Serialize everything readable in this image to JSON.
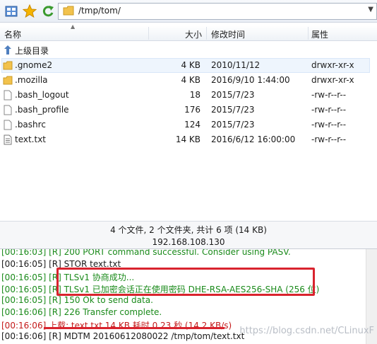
{
  "toolbar": {
    "path": "/tmp/tom/"
  },
  "header": {
    "name": "名称",
    "size": "大小",
    "modified": "修改时间",
    "attrs": "属性"
  },
  "files": [
    {
      "name": "上级目录",
      "size": "",
      "date": "",
      "perm": "",
      "icon": "up-folder-icon"
    },
    {
      "name": ".gnome2",
      "size": "4 KB",
      "date": "2010/11/12",
      "perm": "drwxr-xr-x",
      "icon": "folder-icon"
    },
    {
      "name": ".mozilla",
      "size": "4 KB",
      "date": "2016/9/10 1:44:00",
      "perm": "drwxr-xr-x",
      "icon": "folder-icon"
    },
    {
      "name": ".bash_logout",
      "size": "18",
      "date": "2015/7/23",
      "perm": "-rw-r--r--",
      "icon": "file-icon"
    },
    {
      "name": ".bash_profile",
      "size": "176",
      "date": "2015/7/23",
      "perm": "-rw-r--r--",
      "icon": "file-icon"
    },
    {
      "name": ".bashrc",
      "size": "124",
      "date": "2015/7/23",
      "perm": "-rw-r--r--",
      "icon": "file-icon"
    },
    {
      "name": "text.txt",
      "size": "14 KB",
      "date": "2016/6/12 16:00:00",
      "perm": "-rw-r--r--",
      "icon": "text-file-icon"
    }
  ],
  "status": "4 个文件, 2 个文件夹, 共计 6 项 (14 KB)",
  "host": "192.168.108.130",
  "log": [
    {
      "text": "[00:16:03] [R] 200 PORT command successful. Consider using PASV.",
      "color": "green"
    },
    {
      "text": "[00:16:05] [R] STOR text.txt",
      "color": "black"
    },
    {
      "text": "[00:16:05] [R] TLSv1 协商成功...",
      "color": "green"
    },
    {
      "text": "[00:16:05] [R] TLSv1 已加密会话正在使用密码 DHE-RSA-AES256-SHA (256 位)",
      "color": "green"
    },
    {
      "text": "[00:16:05] [R] 150 Ok to send data.",
      "color": "green"
    },
    {
      "text": "[00:16:06] [R] 226 Transfer complete.",
      "color": "green"
    },
    {
      "text": "[00:16:06] 上载: text.txt 14 KB 耗时 0.23 秒 (14.2 KB/s)",
      "color": "red"
    },
    {
      "text": "[00:16:06] [R] MDTM 20160612080022 /tmp/tom/text.txt",
      "color": "black"
    }
  ],
  "watermark": "https://blog.csdn.net/CLinuxF"
}
